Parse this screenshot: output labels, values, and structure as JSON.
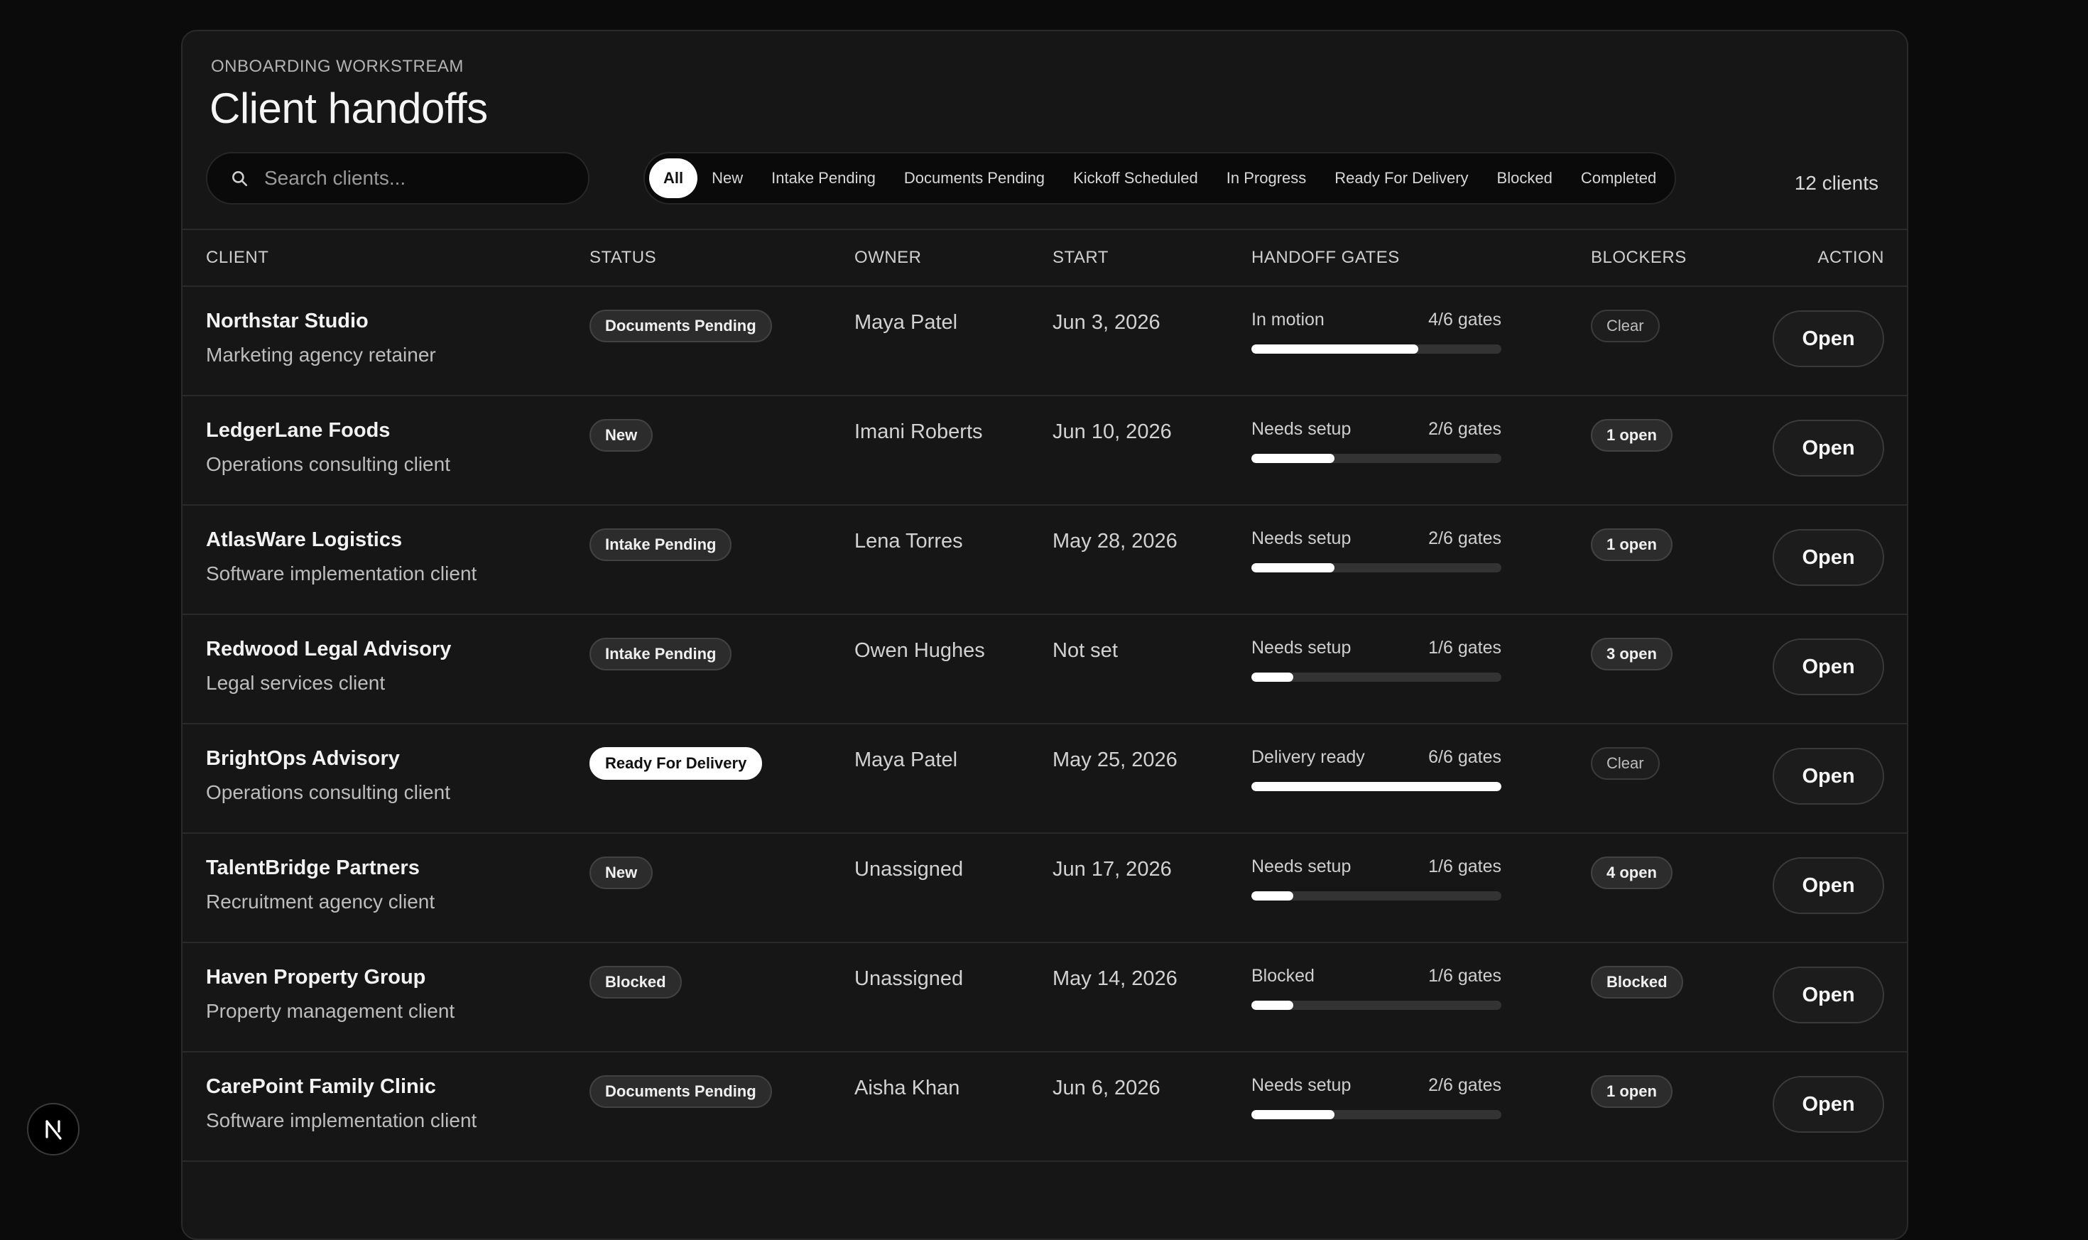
{
  "header": {
    "eyebrow": "ONBOARDING WORKSTREAM",
    "title": "Client handoffs"
  },
  "search": {
    "placeholder": "Search clients...",
    "value": "",
    "icon": "search-icon"
  },
  "filters": {
    "active": "All",
    "items": [
      "All",
      "New",
      "Intake Pending",
      "Documents Pending",
      "Kickoff Scheduled",
      "In Progress",
      "Ready For Delivery",
      "Blocked",
      "Completed"
    ]
  },
  "client_count": "12 clients",
  "columns": {
    "client": "CLIENT",
    "status": "STATUS",
    "owner": "OWNER",
    "start": "START",
    "gates": "HANDOFF GATES",
    "blockers": "BLOCKERS",
    "action": "ACTION"
  },
  "rows": [
    {
      "name": "Northstar Studio",
      "desc": "Marketing agency retainer",
      "status": "Documents Pending",
      "owner": "Maya Patel",
      "start": "Jun 3, 2026",
      "gate_label": "In motion",
      "gates": "4/6 gates",
      "progress": 0.667,
      "blockers": "Clear",
      "action": "Open"
    },
    {
      "name": "LedgerLane Foods",
      "desc": "Operations consulting client",
      "status": "New",
      "owner": "Imani Roberts",
      "start": "Jun 10, 2026",
      "gate_label": "Needs setup",
      "gates": "2/6 gates",
      "progress": 0.333,
      "blockers": "1 open",
      "action": "Open"
    },
    {
      "name": "AtlasWare Logistics",
      "desc": "Software implementation client",
      "status": "Intake Pending",
      "owner": "Lena Torres",
      "start": "May 28, 2026",
      "gate_label": "Needs setup",
      "gates": "2/6 gates",
      "progress": 0.333,
      "blockers": "1 open",
      "action": "Open"
    },
    {
      "name": "Redwood Legal Advisory",
      "desc": "Legal services client",
      "status": "Intake Pending",
      "owner": "Owen Hughes",
      "start": "Not set",
      "gate_label": "Needs setup",
      "gates": "1/6 gates",
      "progress": 0.167,
      "blockers": "3 open",
      "action": "Open"
    },
    {
      "name": "BrightOps Advisory",
      "desc": "Operations consulting client",
      "status": "Ready For Delivery",
      "owner": "Maya Patel",
      "start": "May 25, 2026",
      "gate_label": "Delivery ready",
      "gates": "6/6 gates",
      "progress": 1.0,
      "blockers": "Clear",
      "action": "Open"
    },
    {
      "name": "TalentBridge Partners",
      "desc": "Recruitment agency client",
      "status": "New",
      "owner": "Unassigned",
      "start": "Jun 17, 2026",
      "gate_label": "Needs setup",
      "gates": "1/6 gates",
      "progress": 0.167,
      "blockers": "4 open",
      "action": "Open"
    },
    {
      "name": "Haven Property Group",
      "desc": "Property management client",
      "status": "Blocked",
      "owner": "Unassigned",
      "start": "May 14, 2026",
      "gate_label": "Blocked",
      "gates": "1/6 gates",
      "progress": 0.167,
      "blockers": "Blocked",
      "action": "Open"
    },
    {
      "name": "CarePoint Family Clinic",
      "desc": "Software implementation client",
      "status": "Documents Pending",
      "owner": "Aisha Khan",
      "start": "Jun 6, 2026",
      "gate_label": "Needs setup",
      "gates": "2/6 gates",
      "progress": 0.333,
      "blockers": "1 open",
      "action": "Open"
    }
  ],
  "fab": {
    "letter": "N",
    "icon": "next-logo-icon"
  },
  "colors": {
    "background": "#0b0b0b",
    "panel": "#161616",
    "accent": "#ffffff"
  }
}
